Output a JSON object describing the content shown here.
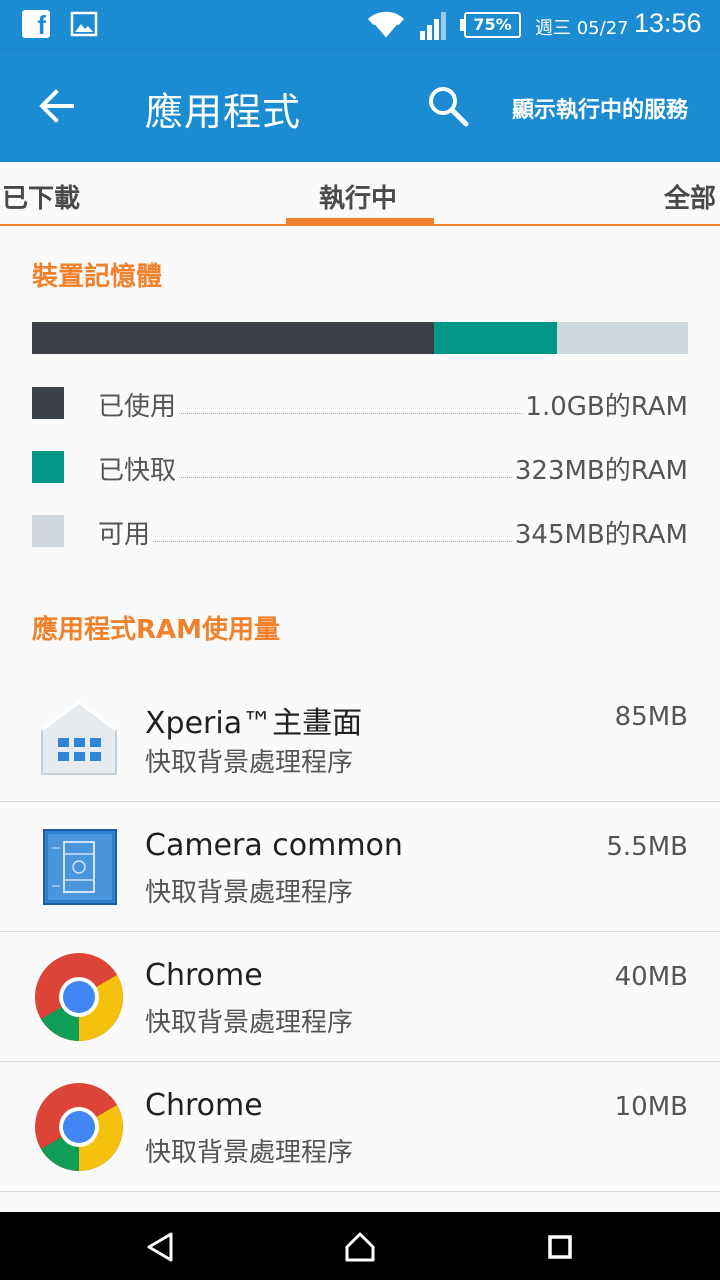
{
  "status_bar": {
    "battery": "75%",
    "date": "週三 05/27",
    "time": "13:56"
  },
  "app_bar": {
    "title": "應用程式",
    "show_services": "顯示執行中的服務"
  },
  "tabs": [
    {
      "label": "已下載"
    },
    {
      "label": "執行中"
    },
    {
      "label": "全部"
    }
  ],
  "memory": {
    "header": "裝置記憶體",
    "used_fraction": 0.613,
    "cached_fraction": 0.188,
    "free_fraction": 0.199,
    "legend": [
      {
        "label": "已使用",
        "value": "1.0GB的RAM",
        "color": "#3b4147"
      },
      {
        "label": "已快取",
        "value": "323MB的RAM",
        "color": "#009688"
      },
      {
        "label": "可用",
        "value": "345MB的RAM",
        "color": "#cfd8dc"
      }
    ]
  },
  "app_ram": {
    "header": "應用程式RAM使用量",
    "apps": [
      {
        "name": "Xperia™主畫面",
        "subtitle": "快取背景處理程序",
        "size": "85MB",
        "icon": "xperia-home-icon"
      },
      {
        "name": "Camera common",
        "subtitle": "快取背景處理程序",
        "size": "5.5MB",
        "icon": "camera-common-icon"
      },
      {
        "name": "Chrome",
        "subtitle": "快取背景處理程序",
        "size": "40MB",
        "icon": "chrome-icon"
      },
      {
        "name": "Chrome",
        "subtitle": "快取背景處理程序",
        "size": "10MB",
        "icon": "chrome-icon"
      }
    ]
  },
  "colors": {
    "primary": "#1b8bd2",
    "accent": "#f0822d"
  }
}
